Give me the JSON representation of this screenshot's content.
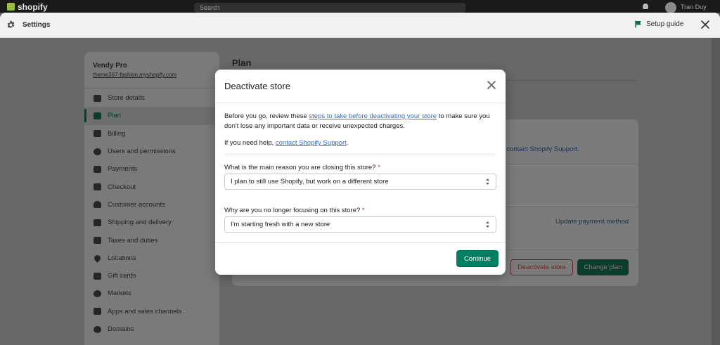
{
  "topbar": {
    "logo": "shopify",
    "search_placeholder": "Search",
    "user": "Tran Duy"
  },
  "settings_header": {
    "title": "Settings",
    "setup_guide": "Setup guide",
    "icons": [
      "gear-icon",
      "flag-icon",
      "close-icon"
    ]
  },
  "sidebar": {
    "store_name": "Vendy Pro",
    "store_url": "theme367-fashion.myshopify.com",
    "items": [
      {
        "label": "Store details",
        "icon": "store-icon"
      },
      {
        "label": "Plan",
        "icon": "plan-icon",
        "active": true
      },
      {
        "label": "Billing",
        "icon": "dollar-icon"
      },
      {
        "label": "Users and permissions",
        "icon": "user-icon"
      },
      {
        "label": "Payments",
        "icon": "credit-card-icon"
      },
      {
        "label": "Checkout",
        "icon": "cart-icon"
      },
      {
        "label": "Customer accounts",
        "icon": "person-icon"
      },
      {
        "label": "Shipping and delivery",
        "icon": "truck-icon"
      },
      {
        "label": "Taxes and duties",
        "icon": "tax-icon"
      },
      {
        "label": "Locations",
        "icon": "pin-icon"
      },
      {
        "label": "Gift cards",
        "icon": "gift-icon"
      },
      {
        "label": "Markets",
        "icon": "globe-icon"
      },
      {
        "label": "Apps and sales channels",
        "icon": "apps-icon"
      },
      {
        "label": "Domains",
        "icon": "globe-icon"
      }
    ]
  },
  "main": {
    "title": "Plan",
    "support_link": ", contact Shopify Support.",
    "update_payment": "Update payment method",
    "deactivate_button": "Deactivate store",
    "change_plan_button": "Change plan"
  },
  "modal": {
    "title": "Deactivate store",
    "intro_before": "Before you go, review these ",
    "intro_link": "steps to take before deactivating your store",
    "intro_after": " to make sure you don't lose any important data or receive unexpected charges.",
    "help_before": "If you need help, ",
    "help_link": "contact Shopify Support",
    "help_after": ".",
    "q1_label": "What is the main reason you are closing this store?",
    "q1_required": "*",
    "q1_value": "I plan to still use Shopify, but work on a different store",
    "q2_label": "Why are you no longer focusing on this store?",
    "q2_required": "*",
    "q2_value": "I'm starting fresh with a new store",
    "continue_label": "Continue"
  },
  "colors": {
    "primary": "#008060",
    "link": "#2c6ecb",
    "required": "#d72c0d"
  }
}
